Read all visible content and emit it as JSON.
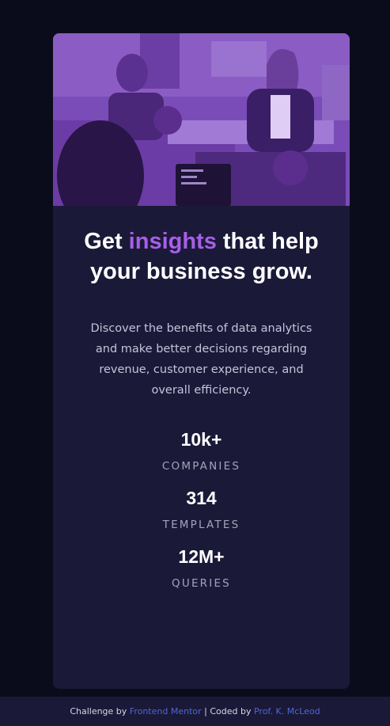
{
  "card": {
    "image_alt": "people working in an office",
    "title_pre": "Get ",
    "title_accent": "insights",
    "title_post": " that help your business grow.",
    "description": "Discover the benefits of data analytics and make better decisions regarding revenue, customer experience, and overall efficiency.",
    "stats": [
      {
        "value": "10k+",
        "label": "COMPANIES"
      },
      {
        "value": "314",
        "label": "TEMPLATES"
      },
      {
        "value": "12M+",
        "label": "QUERIES"
      }
    ]
  },
  "footer": {
    "prefix": "Challenge by ",
    "frontend_mentor": "Frontend Mentor",
    "separator": " | ",
    "coded_by": "Coded by ",
    "author": "Prof. K. McLeod"
  },
  "colors": {
    "background": "#0a0c1c",
    "card": "#1b1938",
    "accent": "#a75fe6",
    "link": "#4c67d1"
  }
}
